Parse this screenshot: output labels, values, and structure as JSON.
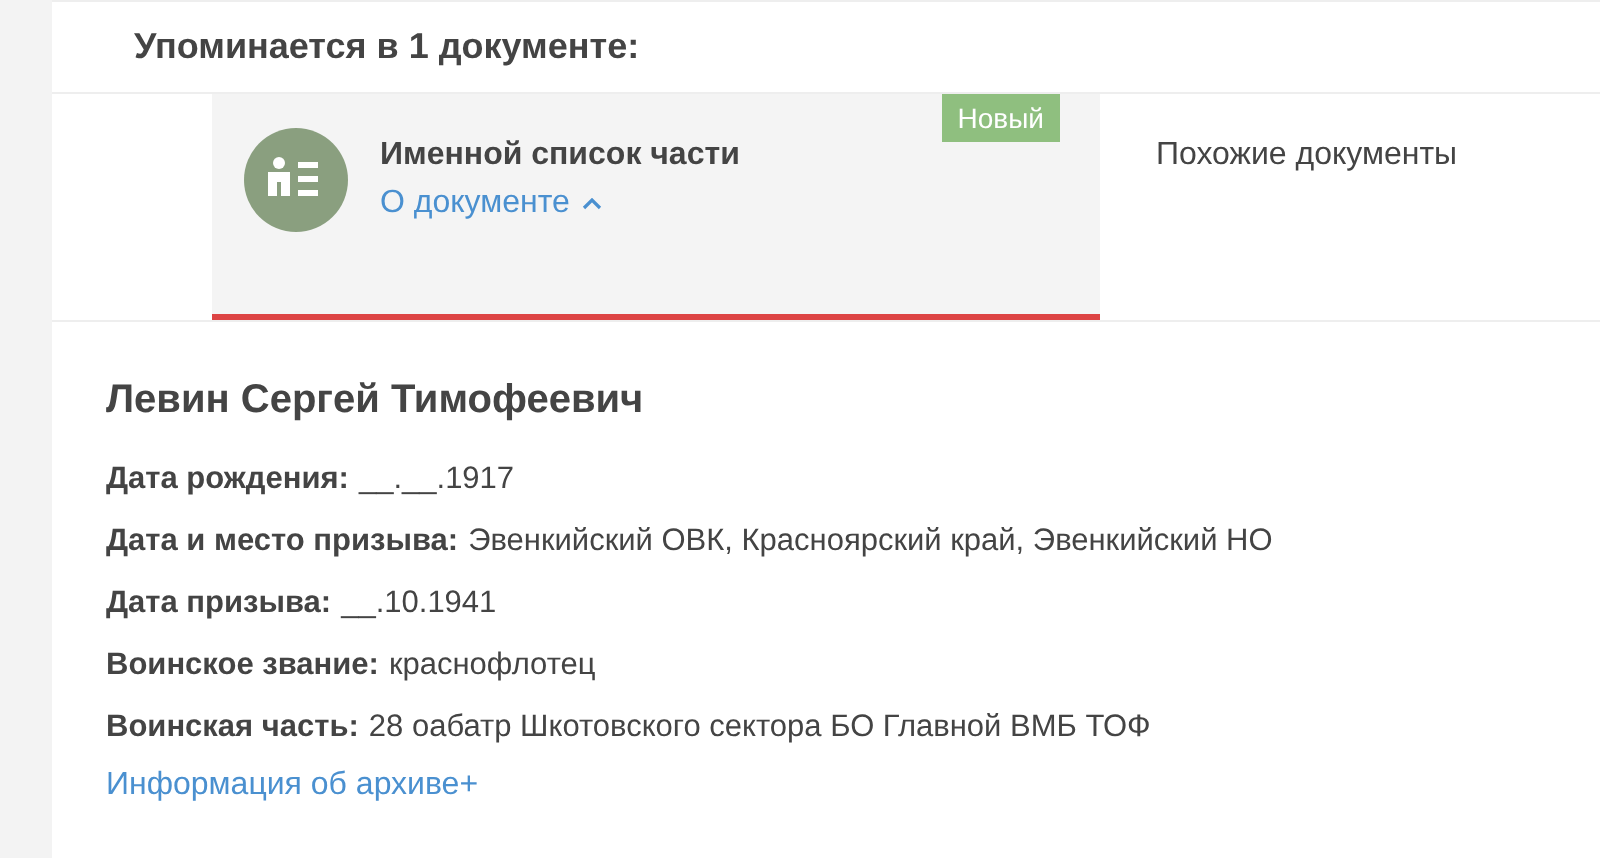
{
  "heading": "Упоминается в 1 документе:",
  "tabs": [
    {
      "title": "Именной список части",
      "badge": "Новый",
      "link": "О документе",
      "expanded": true,
      "selected": true
    },
    {
      "title": "Похожие документы",
      "selected": false
    }
  ],
  "person": {
    "name": "Левин Сергей Тимофеевич",
    "fields": [
      {
        "label": "Дата рождения:",
        "value": "__.__.1917"
      },
      {
        "label": "Дата и место призыва:",
        "value": "Эвенкийский ОВК, Красноярский край, Эвенкийский НО"
      },
      {
        "label": "Дата призыва:",
        "value": "__.10.1941"
      },
      {
        "label": "Воинское звание:",
        "value": "краснофлотец"
      },
      {
        "label": "Воинская часть:",
        "value": "28 оабатр Шкотовского сектора БО Главной ВМБ ТОФ"
      }
    ],
    "archive_link": "Информация об архиве+"
  }
}
